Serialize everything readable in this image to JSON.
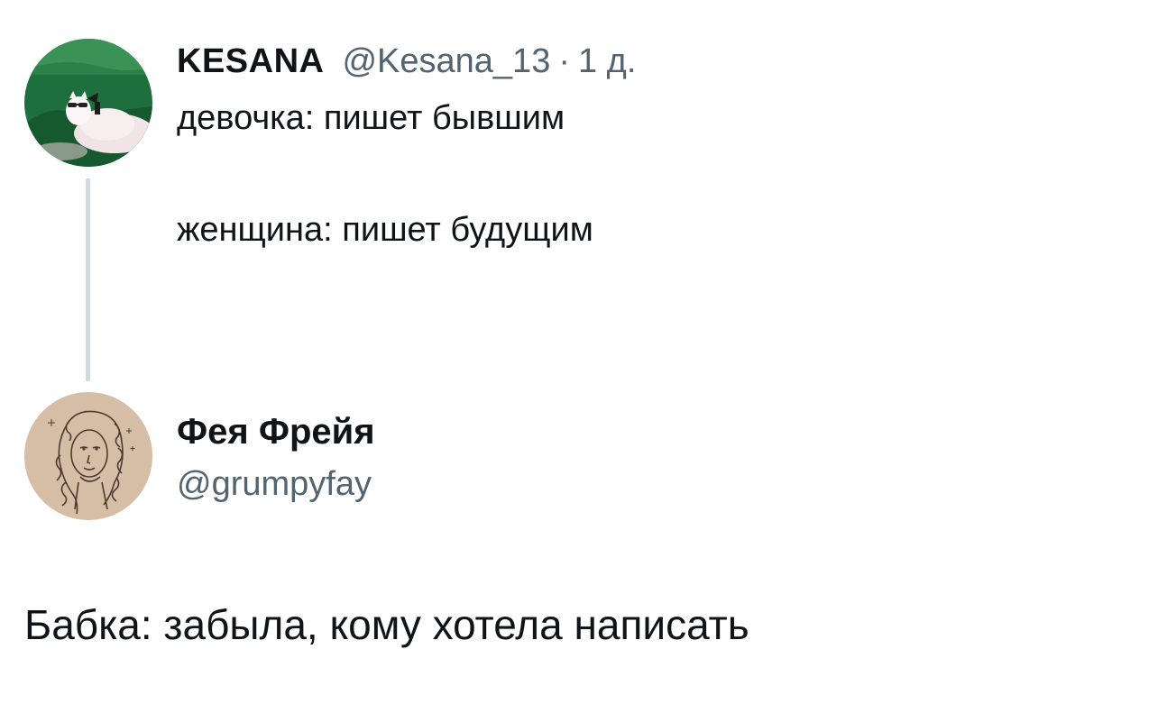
{
  "parent_tweet": {
    "display_name": "KESANA",
    "handle": "@Kesana_13",
    "separator": "·",
    "timestamp": "1 д.",
    "text_line_1": "девочка: пишет бывшим",
    "text_line_2": "женщина: пишет будущим"
  },
  "reply_tweet": {
    "display_name": "Фея Фрейя",
    "handle": "@grumpyfay",
    "text": "Бабка: забыла, кому хотела написать"
  },
  "colors": {
    "text_primary": "#0f1419",
    "text_secondary": "#536471",
    "thread_line": "#cfd9de",
    "background": "#ffffff"
  }
}
